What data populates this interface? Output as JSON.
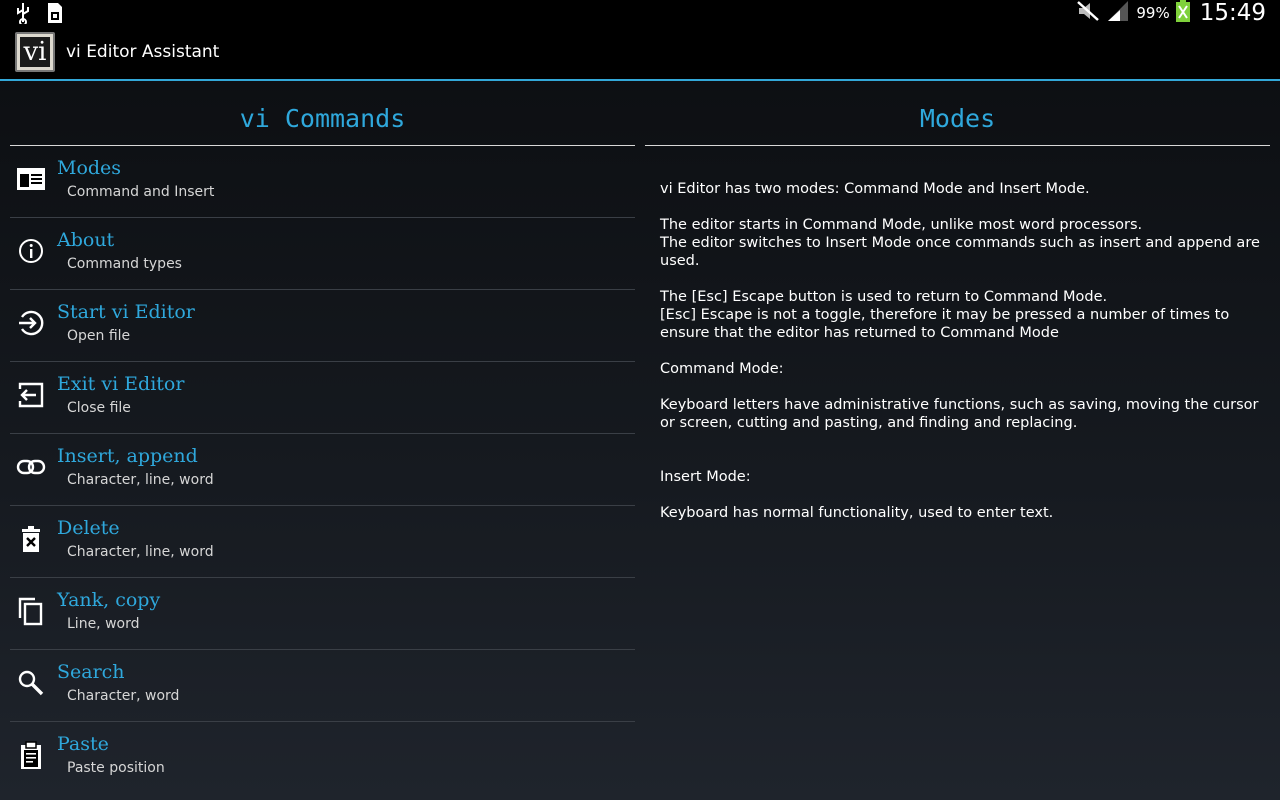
{
  "status_bar": {
    "battery_percent": "99%",
    "clock": "15:49"
  },
  "app": {
    "icon_text": "vi",
    "title": "vi Editor Assistant"
  },
  "left_pane": {
    "title": "vi Commands",
    "items": [
      {
        "icon": "window-icon",
        "title": "Modes",
        "subtitle": "Command and Insert"
      },
      {
        "icon": "info-icon",
        "title": "About",
        "subtitle": "Command types"
      },
      {
        "icon": "enter-icon",
        "title": "Start vi Editor",
        "subtitle": "Open file"
      },
      {
        "icon": "exit-icon",
        "title": "Exit vi Editor",
        "subtitle": "Close file"
      },
      {
        "icon": "link-icon",
        "title": "Insert, append",
        "subtitle": "Character, line, word"
      },
      {
        "icon": "trash-icon",
        "title": "Delete",
        "subtitle": "Character, line, word"
      },
      {
        "icon": "copy-icon",
        "title": "Yank, copy",
        "subtitle": "Line, word"
      },
      {
        "icon": "search-icon",
        "title": "Search",
        "subtitle": "Character, word"
      },
      {
        "icon": "clipboard-icon",
        "title": "Paste",
        "subtitle": "Paste position"
      }
    ]
  },
  "right_pane": {
    "title": "Modes",
    "body": "vi Editor has two modes: Command Mode and Insert Mode.\n\nThe editor starts in Command Mode, unlike most word processors.\nThe editor switches to Insert Mode once commands such as insert and append are used.\n\nThe [Esc] Escape button is used to return to Command Mode.\n[Esc] Escape is not a toggle, therefore it may be pressed a number of times to ensure that the editor has returned to Command Mode\n\nCommand Mode:\n\nKeyboard letters have administrative functions, such as saving, moving the cursor or screen, cutting and pasting, and finding and replacing.\n\n\nInsert Mode:\n\nKeyboard has normal functionality, used to enter text."
  }
}
